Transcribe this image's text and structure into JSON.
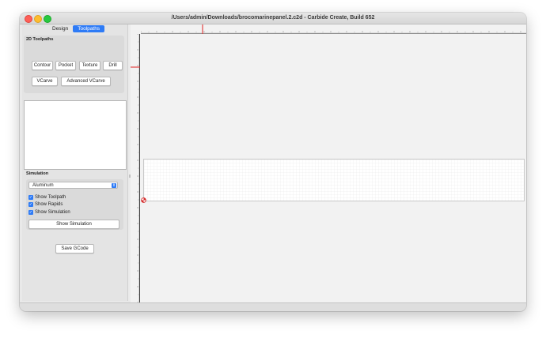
{
  "window": {
    "title": "/Users/admin/Downloads/brocomarinepanel.2.c2d - Carbide Create, Build 652"
  },
  "tabs": [
    {
      "label": "Design",
      "active": false
    },
    {
      "label": "Toolpaths",
      "active": true
    }
  ],
  "toolpaths_group": {
    "label": "2D Toolpaths",
    "buttons": [
      "Contour",
      "Pocket",
      "Texture",
      "Drill",
      "VCarve",
      "Advanced VCarve"
    ]
  },
  "simulation": {
    "label": "Simulation",
    "material": {
      "selected": "Aluminum"
    },
    "checkboxes": [
      {
        "label": "Show Toolpath",
        "checked": true
      },
      {
        "label": "Show Rapids",
        "checked": true
      },
      {
        "label": "Show Simulation",
        "checked": true
      }
    ],
    "show_button": "Show Simulation"
  },
  "save_gcode": "Save GCode",
  "colors": {
    "accent": "#2e7bf6",
    "ruler_marker": "#e02020",
    "origin": "#d42a2a"
  }
}
